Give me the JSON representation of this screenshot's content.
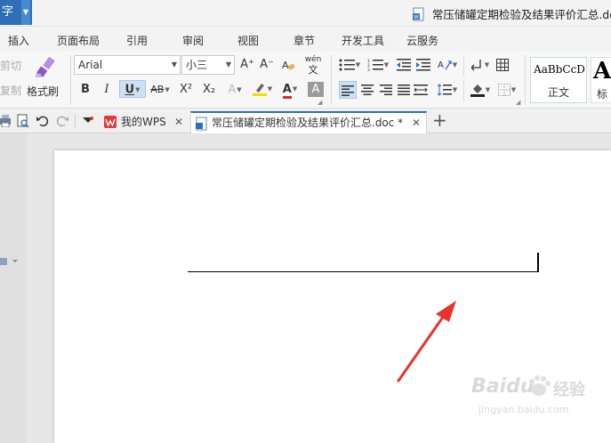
{
  "titlebar": {
    "app_button_label": "字",
    "document_title": "常压储罐定期检验及结果评价汇总.doc"
  },
  "menu": {
    "items": [
      "插入",
      "页面布局",
      "引用",
      "审阅",
      "视图",
      "章节",
      "开发工具",
      "云服务"
    ]
  },
  "ribbon": {
    "cut_label": "剪切",
    "copy_label": "复制",
    "format_painter_label": "格式刷",
    "font_name": "Arial",
    "font_size": "小三",
    "grow_font": "A⁺",
    "shrink_font": "A⁻",
    "phonetic_label": "wén",
    "bold": "B",
    "italic": "I",
    "underline": "U",
    "strikethrough": "AB",
    "superscript": "X²",
    "subscript": "X₂",
    "font_color_glyph": "A",
    "char_shading_glyph": "A",
    "styles": [
      {
        "sample": "AaBbCcD",
        "name": "正文"
      },
      {
        "sample": "Aa",
        "name": "标"
      }
    ]
  },
  "tabs": {
    "home_tab_label": "我的WPS",
    "document_tab_label": "常压储罐定期检验及结果评价汇总.doc *",
    "new_tab_glyph": "+"
  },
  "watermark": {
    "brand": "Baidu",
    "brand_cn": "经验",
    "url": "jingyan.baidu.com"
  },
  "colors": {
    "accent": "#2f6fb8",
    "arrow": "#e8322c",
    "font_color_underline": "#d22d2d",
    "highlight_underline": "#f2e100"
  }
}
